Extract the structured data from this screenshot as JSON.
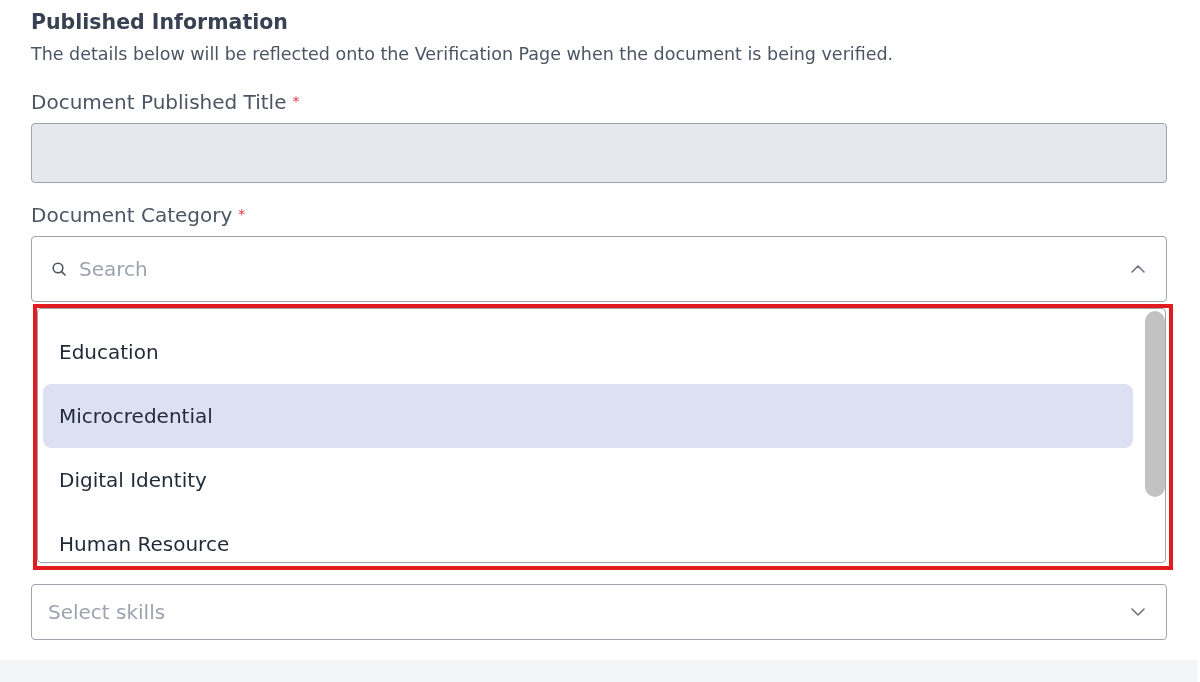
{
  "section": {
    "title": "Published Information",
    "description": "The details below will be reflected onto the Verification Page when the document is being verified."
  },
  "fields": [
    {
      "kind": "text",
      "label": "Document Published Title",
      "required_mark": "*",
      "disabled": true
    },
    {
      "kind": "combo",
      "label": "Document Category",
      "required_mark": "*",
      "placeholder": "Search",
      "expanded": true,
      "highlight_frame": true,
      "options": [
        {
          "label": "Education",
          "selected": false
        },
        {
          "label": "Microcredential",
          "selected": true
        },
        {
          "label": "Digital Identity",
          "selected": false
        },
        {
          "label": "Human Resource",
          "selected": false
        }
      ]
    },
    {
      "kind": "select",
      "placeholder": "Select skills",
      "expanded": false
    }
  ]
}
